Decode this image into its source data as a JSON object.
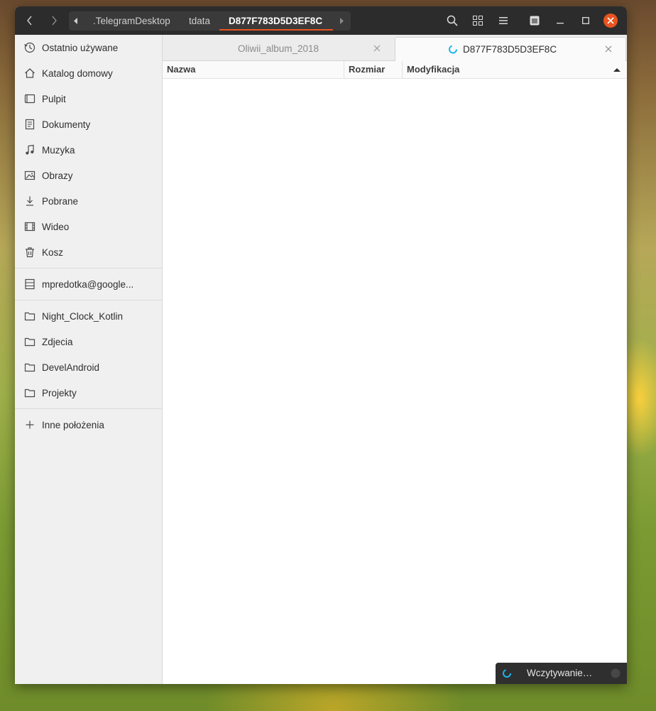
{
  "headerbar": {
    "back_icon": "chevron-left-icon",
    "forward_icon": "chevron-right-icon",
    "path": [
      ".TelegramDesktop",
      "tdata",
      "D877F783D5D3EF8C"
    ],
    "search_icon": "search-icon",
    "view_icon": "grid-view-icon",
    "menu_icon": "hamburger-menu-icon",
    "accent_color": "#e95420"
  },
  "sidebar": {
    "places": [
      {
        "label": "Ostatnio używane",
        "icon": "clock-icon"
      },
      {
        "label": "Katalog domowy",
        "icon": "home-icon"
      },
      {
        "label": "Pulpit",
        "icon": "desktop-icon"
      },
      {
        "label": "Dokumenty",
        "icon": "document-icon"
      },
      {
        "label": "Muzyka",
        "icon": "music-icon"
      },
      {
        "label": "Obrazy",
        "icon": "image-icon"
      },
      {
        "label": "Pobrane",
        "icon": "download-icon"
      },
      {
        "label": "Wideo",
        "icon": "video-icon"
      },
      {
        "label": "Kosz",
        "icon": "trash-icon"
      }
    ],
    "network": {
      "label": "mpredotka@google...",
      "icon": "network-drive-icon"
    },
    "bookmarks": [
      {
        "label": "Night_Clock_Kotlin",
        "icon": "folder-icon"
      },
      {
        "label": "Zdjecia",
        "icon": "folder-icon"
      },
      {
        "label": "DevelAndroid",
        "icon": "folder-icon"
      },
      {
        "label": "Projekty",
        "icon": "folder-icon"
      }
    ],
    "other_locations": {
      "label": "Inne położenia",
      "icon": "plus-icon"
    }
  },
  "tabs": [
    {
      "label": "Oliwii_album_2018",
      "active": false
    },
    {
      "label": "D877F783D5D3EF8C",
      "active": true,
      "loading": true
    }
  ],
  "columns": {
    "name": "Nazwa",
    "size": "Rozmiar",
    "modified": "Modyfikacja"
  },
  "status": {
    "label": "Wczytywanie…"
  }
}
